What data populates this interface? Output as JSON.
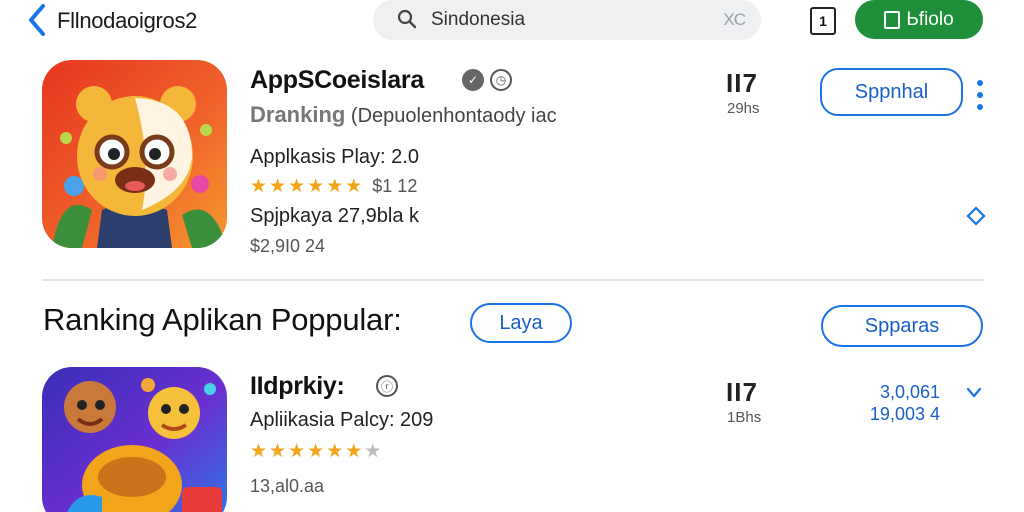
{
  "topbar": {
    "title": "Fllnodaoigros2",
    "search": {
      "value": "Sindonesia",
      "clear": "XC"
    },
    "badge": "1",
    "action_label": "Ьfiolo"
  },
  "app1": {
    "name": "AppSCoeislara",
    "rank_bold": "Dranking",
    "rank_text": "(Depuolenhontaody iac",
    "category": "Applkasis Play: 2.0",
    "rating_text": "$1 12",
    "rating": 4.5,
    "downloads": "Spjpkaya 27,9bla k",
    "price": "$2,9I0 24",
    "rank_number": "II7",
    "rank_sub": "29hs",
    "button_label": "Sppnhal"
  },
  "section": {
    "title": "Ranking Aplikan Poppular:",
    "pill_label": "Laya",
    "button_label": "Spparas"
  },
  "app2": {
    "name": "IIdprkiy:",
    "category": "Apliikasia Palcy: 209",
    "rating": 4.5,
    "downloads": "13,al0.aa",
    "rank_number": "II7",
    "rank_sub": "1Bhs",
    "value1": "3,0,061",
    "value2": "19,003 4"
  },
  "colors": {
    "accent": "#1a73e8",
    "green": "#1f8f3a",
    "star": "#f2a51a"
  }
}
